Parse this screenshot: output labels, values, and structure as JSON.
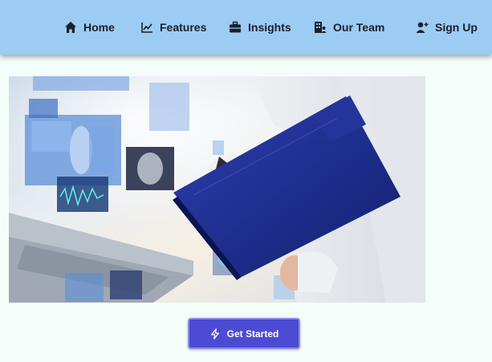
{
  "nav": {
    "items": [
      {
        "label": "Home",
        "icon": "home-icon"
      },
      {
        "label": "Features",
        "icon": "chart-line-icon"
      },
      {
        "label": "Insights",
        "icon": "briefcase-icon"
      },
      {
        "label": "Our Team",
        "icon": "building-user-icon"
      },
      {
        "label": "Sign Up",
        "icon": "user-plus-icon"
      }
    ]
  },
  "hero": {
    "image": "medical-tech-doctor-clipboard-image"
  },
  "cta": {
    "label": "Get Started",
    "icon": "bolt-icon"
  },
  "colors": {
    "navbar": "#9ccbf4",
    "background": "#f3fdf9",
    "button": "#4d4ad4"
  }
}
